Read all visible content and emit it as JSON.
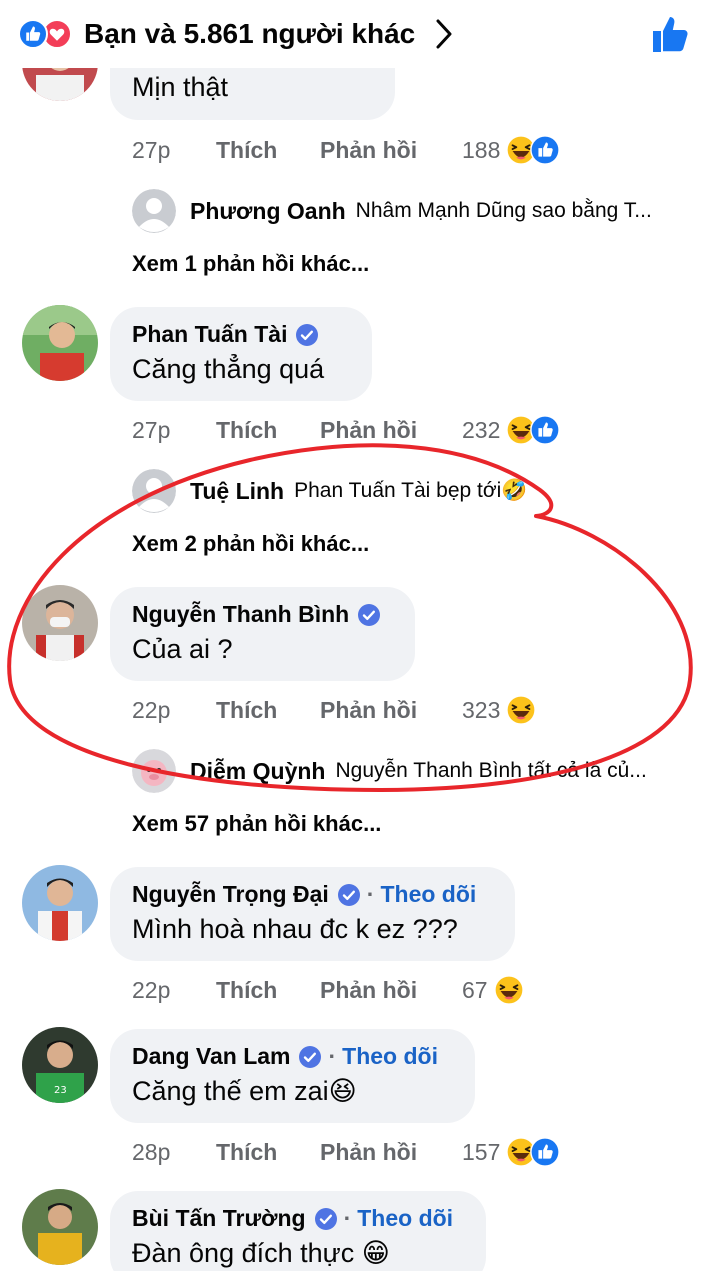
{
  "header": {
    "reactions_text": "Bạn và 5.861 người khác"
  },
  "comments": [
    {
      "text": "Mịn thật",
      "time": "27p",
      "like": "Thích",
      "reply": "Phản hồi",
      "count": "188",
      "reply_preview": {
        "name": "Phương Oanh",
        "text": "Nhâm Mạnh Dũng sao bằng T..."
      },
      "more": "Xem 1 phản hồi khác..."
    },
    {
      "name": "Phan Tuấn Tài",
      "text": "Căng thẳng quá",
      "time": "27p",
      "like": "Thích",
      "reply": "Phản hồi",
      "count": "232",
      "reply_preview": {
        "name": "Tuệ Linh",
        "text": "Phan Tuấn Tài bẹp tới🤣"
      },
      "more": "Xem 2 phản hồi khác..."
    },
    {
      "name": "Nguyễn Thanh Bình",
      "text": "Của ai ?",
      "time": "22p",
      "like": "Thích",
      "reply": "Phản hồi",
      "count": "323",
      "reply_preview": {
        "name": "Diễm Quỳnh",
        "text": "Nguyễn Thanh Bình tất cả là củ..."
      },
      "more": "Xem 57 phản hồi khác..."
    },
    {
      "name": "Nguyễn Trọng Đại",
      "follow": "Theo dõi",
      "text": "Mình hoà nhau đc k ez ???",
      "time": "22p",
      "like": "Thích",
      "reply": "Phản hồi",
      "count": "67"
    },
    {
      "name": "Dang Van Lam",
      "follow": "Theo dõi",
      "text": "Căng thế em zai😆",
      "time": "28p",
      "like": "Thích",
      "reply": "Phản hồi",
      "count": "157"
    },
    {
      "name": "Bùi Tấn Trường",
      "follow": "Theo dõi",
      "text": "Đàn ông đích thực 😁"
    }
  ],
  "colors": {
    "accent": "#1877f2",
    "follow": "#1a63c6",
    "bubble": "#f0f2f5",
    "muted": "#65676b",
    "annotation_circle": "#e8262b"
  },
  "icons": [
    "like-icon",
    "love-icon",
    "chevron-right-icon",
    "thumbs-up-icon",
    "verified-icon",
    "haha-emoji-icon",
    "avatar"
  ]
}
